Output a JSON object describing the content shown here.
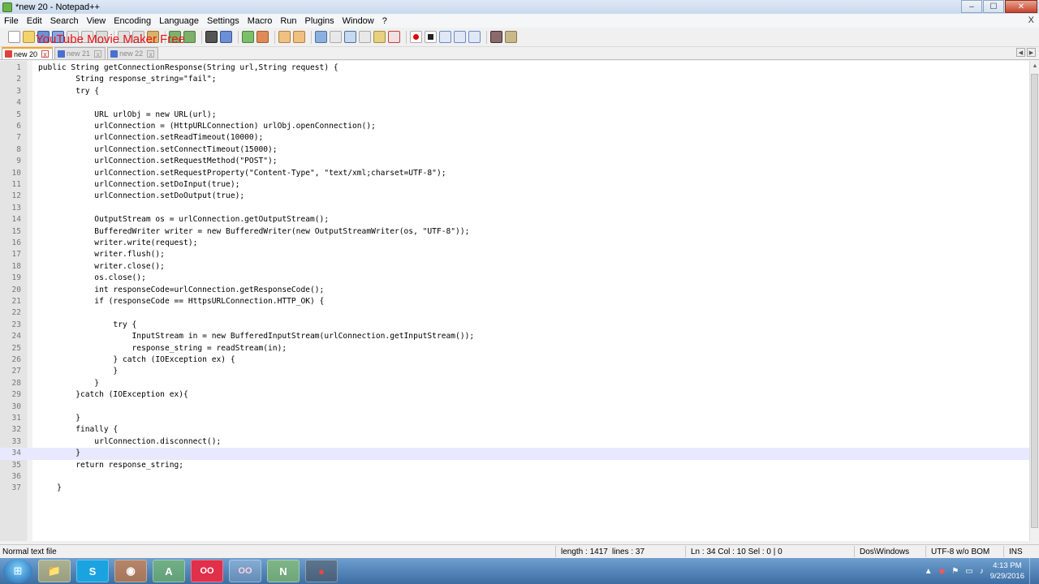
{
  "window": {
    "title": "*new 20 - Notepad++",
    "watermark": "YouTube Movie Maker Free",
    "controls": {
      "minimize": "–",
      "maximize": "☐",
      "close": "✕"
    }
  },
  "menu": {
    "items": [
      "File",
      "Edit",
      "Search",
      "View",
      "Encoding",
      "Language",
      "Settings",
      "Macro",
      "Run",
      "Plugins",
      "Window",
      "?"
    ],
    "close_glyph": "X"
  },
  "tabs": [
    {
      "label": "new 20",
      "active": true,
      "color": "#e04040"
    },
    {
      "label": "new 21",
      "active": false,
      "color": "#4a6fd0"
    },
    {
      "label": "new 22",
      "active": false,
      "color": "#4a6fd0"
    }
  ],
  "tab_close_glyph": "x",
  "tab_scroll": {
    "left": "◀",
    "right": "▶"
  },
  "editor": {
    "current_line": 34,
    "lines": [
      "public String getConnectionResponse(String url,String request) {",
      "        String response_string=\"fail\";",
      "        try {",
      "",
      "            URL urlObj = new URL(url);",
      "            urlConnection = (HttpURLConnection) urlObj.openConnection();",
      "            urlConnection.setReadTimeout(10000);",
      "            urlConnection.setConnectTimeout(15000);",
      "            urlConnection.setRequestMethod(\"POST\");",
      "            urlConnection.setRequestProperty(\"Content-Type\", \"text/xml;charset=UTF-8\");",
      "            urlConnection.setDoInput(true);",
      "            urlConnection.setDoOutput(true);",
      "",
      "            OutputStream os = urlConnection.getOutputStream();",
      "            BufferedWriter writer = new BufferedWriter(new OutputStreamWriter(os, \"UTF-8\"));",
      "            writer.write(request);",
      "            writer.flush();",
      "            writer.close();",
      "            os.close();",
      "            int responseCode=urlConnection.getResponseCode();",
      "            if (responseCode == HttpsURLConnection.HTTP_OK) {",
      "",
      "                try {",
      "                    InputStream in = new BufferedInputStream(urlConnection.getInputStream());",
      "                    response_string = readStream(in);",
      "                } catch (IOException ex) {",
      "                }",
      "            }",
      "        }catch (IOException ex){",
      "",
      "        }",
      "        finally {",
      "            urlConnection.disconnect();",
      "        }",
      "        return response_string;",
      "",
      "    }"
    ]
  },
  "status": {
    "file_type": "Normal text file",
    "length": "length : 1417",
    "lines": "lines : 37",
    "position": "Ln : 34    Col : 10    Sel : 0 | 0",
    "eol": "Dos\\Windows",
    "encoding": "UTF-8 w/o BOM",
    "mode": "INS"
  },
  "taskbar": {
    "apps": [
      {
        "name": "explorer",
        "glyph": "📁"
      },
      {
        "name": "skype",
        "glyph": "S"
      },
      {
        "name": "firefox",
        "glyph": "◉"
      },
      {
        "name": "android-studio",
        "glyph": "A"
      },
      {
        "name": "app-oo-red",
        "glyph": "OO"
      },
      {
        "name": "app-oo",
        "glyph": "OO"
      },
      {
        "name": "notepadpp",
        "glyph": "N"
      },
      {
        "name": "media",
        "glyph": "●"
      }
    ],
    "tray_glyphs": [
      "▲",
      "◆",
      "⚑",
      "▭",
      "♪"
    ],
    "time": "4:13 PM",
    "date": "9/29/2016"
  }
}
